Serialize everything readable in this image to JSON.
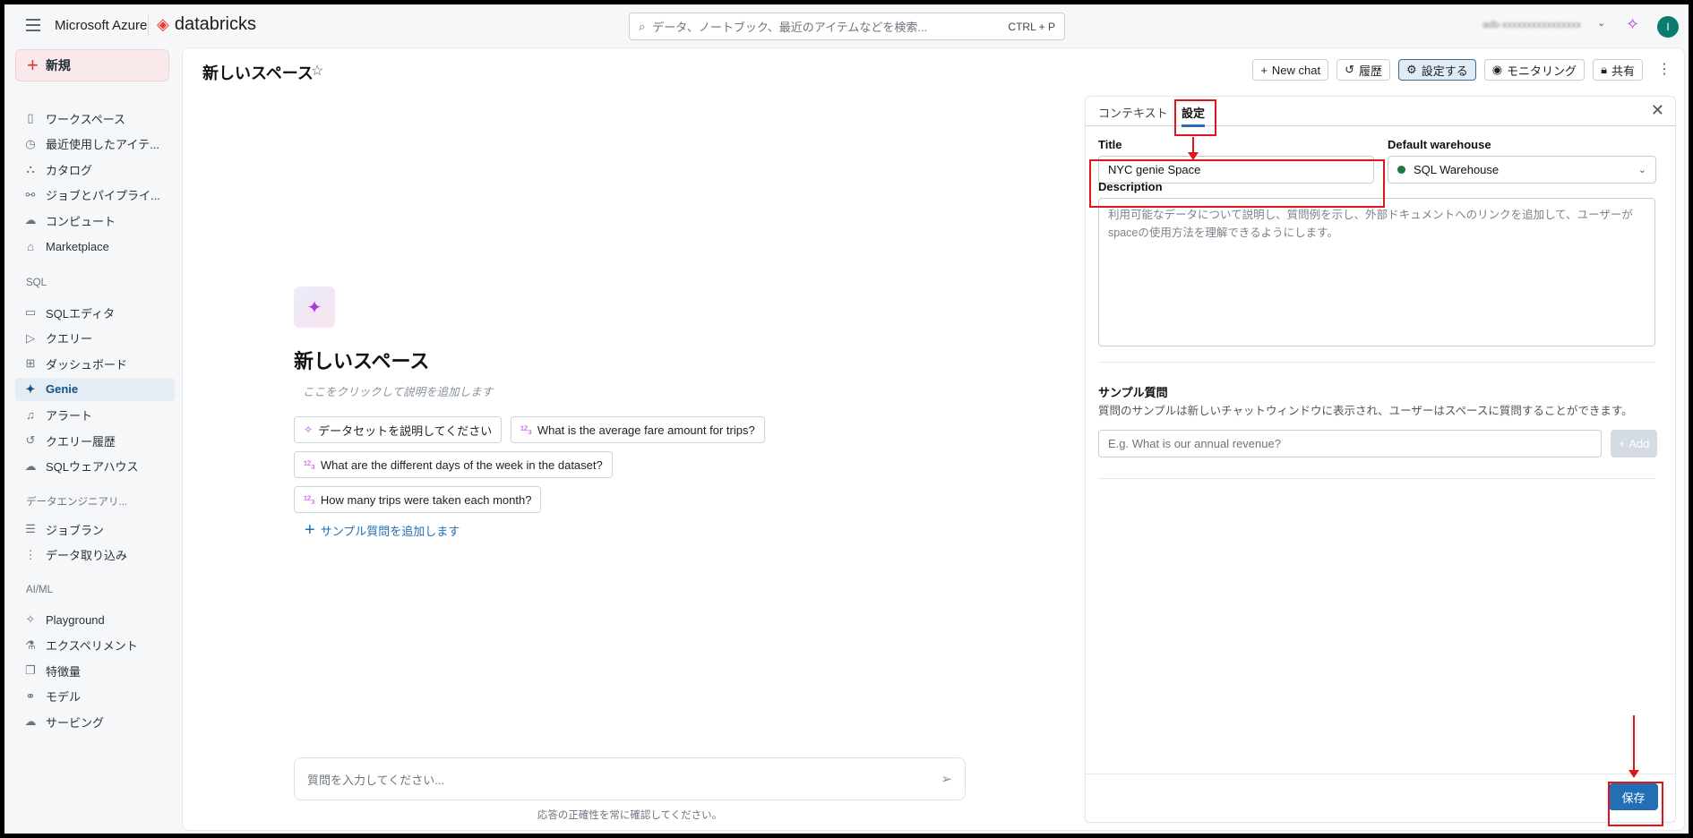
{
  "topbar": {
    "brand_azure": "Microsoft Azure",
    "brand_databricks": "databricks",
    "search_placeholder": "データ、ノートブック、最近のアイテムなどを検索...",
    "search_shortcut": "CTRL + P",
    "workspace_name": "adb-xxxxxxxxxxxxxxxx",
    "avatar_initial": "I"
  },
  "sidebar": {
    "new_label": "新規",
    "items": [
      {
        "label": "ワークスペース",
        "icon": "▯"
      },
      {
        "label": "最近使用したアイテ...",
        "icon": "◷"
      },
      {
        "label": "カタログ",
        "icon": "⛬"
      },
      {
        "label": "ジョブとパイプライ...",
        "icon": "⚯"
      },
      {
        "label": "コンピュート",
        "icon": "☁"
      },
      {
        "label": "Marketplace",
        "icon": "⌂"
      }
    ],
    "sql_header": "SQL",
    "sql_items": [
      {
        "label": "SQLエディタ",
        "icon": "▭"
      },
      {
        "label": "クエリー",
        "icon": "▷"
      },
      {
        "label": "ダッシュボード",
        "icon": "⊞"
      },
      {
        "label": "Genie",
        "icon": "✦"
      },
      {
        "label": "アラート",
        "icon": "♫"
      },
      {
        "label": "クエリー履歴",
        "icon": "↺"
      },
      {
        "label": "SQLウェアハウス",
        "icon": "☁"
      }
    ],
    "de_header": "データエンジニアリ...",
    "de_items": [
      {
        "label": "ジョブラン",
        "icon": "☰"
      },
      {
        "label": "データ取り込み",
        "icon": "⋮"
      }
    ],
    "ai_header": "AI/ML",
    "ai_items": [
      {
        "label": "Playground",
        "icon": "✧"
      },
      {
        "label": "エクスペリメント",
        "icon": "⚗"
      },
      {
        "label": "特徴量",
        "icon": "❐"
      },
      {
        "label": "モデル",
        "icon": "⚭"
      },
      {
        "label": "サービング",
        "icon": "☁"
      }
    ]
  },
  "page": {
    "title": "新しいスペース",
    "buttons": {
      "new_chat": "New chat",
      "history": "履歴",
      "settings": "設定する",
      "monitoring": "モニタリング",
      "share": "共有"
    }
  },
  "center": {
    "title": "新しいスペース",
    "description_placeholder": "ここをクリックして説明を追加します",
    "sample_questions": [
      "データセットを説明してください",
      "What is the average fare amount for trips?",
      "What are the different days of the week in the dataset?",
      "How many trips were taken each month?"
    ],
    "add_sample": "サンプル質問を追加します",
    "chat_placeholder": "質問を入力してください...",
    "disclaimer": "応答の正確性を常に確認してください。"
  },
  "panel": {
    "tabs": [
      "コンテキスト",
      "設定"
    ],
    "title_label": "Title",
    "title_value": "NYC genie Space",
    "warehouse_label": "Default warehouse",
    "warehouse_value": "SQL Warehouse",
    "description_label": "Description",
    "description_placeholder": "利用可能なデータについて説明し、質問例を示し、外部ドキュメントへのリンクを追加して、ユーザーがspaceの使用方法を理解できるようにします。",
    "sample_label": "サンプル質問",
    "sample_help": "質問のサンプルは新しいチャットウィンドウに表示され、ユーザーはスペースに質問することができます。",
    "sample_placeholder": "E.g. What is our annual revenue?",
    "add_label": "Add",
    "save_label": "保存"
  }
}
